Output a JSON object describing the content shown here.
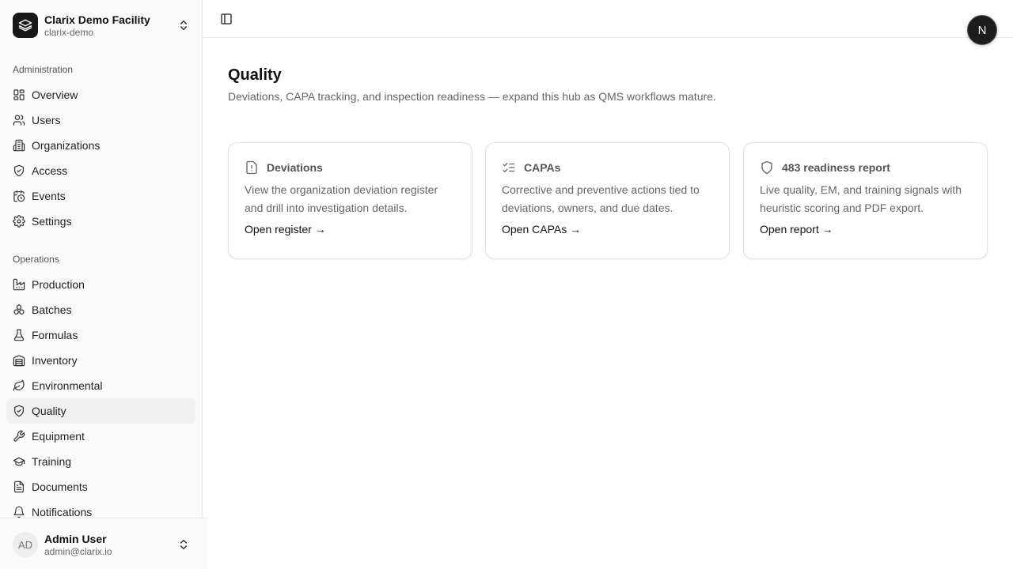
{
  "org": {
    "name": "Clarix Demo Facility",
    "slug": "clarix-demo",
    "logo_icon": "layers-icon"
  },
  "sidebar": {
    "groups": [
      {
        "label": "Administration",
        "items": [
          {
            "label": "Overview",
            "icon": "dashboard-icon"
          },
          {
            "label": "Users",
            "icon": "users-icon"
          },
          {
            "label": "Organizations",
            "icon": "building-icon"
          },
          {
            "label": "Access",
            "icon": "shield-check-icon"
          },
          {
            "label": "Events",
            "icon": "calendar-clock-icon"
          },
          {
            "label": "Settings",
            "icon": "gear-icon"
          }
        ]
      },
      {
        "label": "Operations",
        "items": [
          {
            "label": "Production",
            "icon": "factory-icon"
          },
          {
            "label": "Batches",
            "icon": "boxes-icon"
          },
          {
            "label": "Formulas",
            "icon": "flask-icon"
          },
          {
            "label": "Inventory",
            "icon": "warehouse-icon"
          },
          {
            "label": "Environmental",
            "icon": "leaf-icon"
          },
          {
            "label": "Quality",
            "icon": "shield-check-icon",
            "active": true
          },
          {
            "label": "Equipment",
            "icon": "wrench-icon"
          },
          {
            "label": "Training",
            "icon": "graduation-cap-icon"
          },
          {
            "label": "Documents",
            "icon": "file-text-icon"
          },
          {
            "label": "Notifications",
            "icon": "bell-icon"
          }
        ]
      }
    ]
  },
  "user": {
    "initials": "AD",
    "name": "Admin User",
    "email": "admin@clarix.io"
  },
  "topbar": {
    "profile_initial": "N"
  },
  "page": {
    "title": "Quality",
    "subtitle": "Deviations, CAPA tracking, and inspection readiness — expand this hub as QMS workflows mature."
  },
  "cards": [
    {
      "title": "Deviations",
      "icon": "file-alert-icon",
      "description": "View the organization deviation register and drill into investigation details.",
      "link": "Open register →"
    },
    {
      "title": "CAPAs",
      "icon": "list-checks-icon",
      "description": "Corrective and preventive actions tied to deviations, owners, and due dates.",
      "link": "Open CAPAs →"
    },
    {
      "title": "483 readiness report",
      "icon": "shield-icon",
      "description": "Live quality, EM, and training signals with heuristic scoring and PDF export.",
      "link": "Open report →"
    }
  ]
}
